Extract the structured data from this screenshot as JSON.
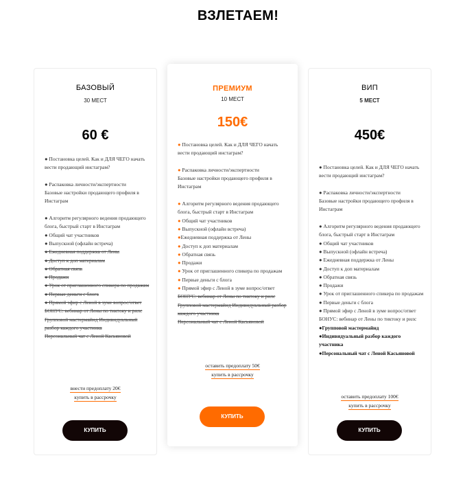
{
  "page": {
    "title": "ВЗЛЕТАЕМ!"
  },
  "colors": {
    "accent": "#ff6b00",
    "button_dark": "#120606"
  },
  "plans": [
    {
      "name": "БАЗОВЫЙ",
      "seats": "30 МЕСТ",
      "price": "60 €",
      "features": [
        "● Постановка целей. Как и ДЛЯ ЧЕГО начать вести продающий инстаграм?",
        "● Распаковка личности/экспертности\nБазовые настройки продающего профиля в Инстаграм",
        "● Алгоритм регулярного ведения продающего блога, быстрый старт в Инстаграм",
        "● Общий чат участников",
        "● Выпускной (офлайн встреча)",
        "● Ежедневная поддержка от Лены",
        "● Доступ к доп материалам",
        "● Обратная связь",
        "● Продажи",
        "● Урок от приглашенного спикера по продажам",
        "● Первые деньги с блога",
        "● Прямой эфир с Леной в зуме вопрос/ответ",
        "БОНУС: вебинар от Лены по тиктоку и рилс",
        "Групповой мастермайнд Индивидуальный разбор каждого участника",
        "Персональный чат с Леной Касьяновой"
      ],
      "link_prepay": "внести предоплату 20€",
      "link_installment": "купить в рассрочку",
      "buy_label": "КУПИТЬ"
    },
    {
      "name": "ПРЕМИУМ",
      "seats": "10 МЕСТ",
      "price": "150€",
      "features": [
        "● Постановка целей. Как и ДЛЯ ЧЕГО начать вести продающий инстаграм?",
        "● Распаковка личности/экспертности\nБазовые настройки продающего профиля в Инстаграм",
        "● Алгоритм регулярного ведения продающего блога, быстрый старт в Инстаграм",
        "● Общий чат участников",
        "● Выпускной (офлайн встреча)",
        "●Ежедневная поддержка от Лены",
        "● Доступ к доп материалам",
        "● Обратная связь",
        "● Продажи",
        "● Урок от приглашенного спикера по продажам",
        "● Первые деньги с блога",
        "● Прямой эфир с Леной в зуме вопрос/ответ",
        "БОНУС: вебинар от Лены по тиктоку и рилс Групповой мастермайнд Индивидуальный разбор каждого участника",
        "Персональный чат с Леной Касьяновой"
      ],
      "link_prepay": "оставить предоплату 50€",
      "link_installment": "купить в рассрочку",
      "buy_label": "КУПИТЬ"
    },
    {
      "name": "ВИП",
      "seats": "5 МЕСТ",
      "price": "450€",
      "features": [
        "● Постановка целей. Как и ДЛЯ ЧЕГО начать вести продающий инстаграм?",
        "● Распаковка личности/экспертности\nБазовые настройки продающего профиля в Инстаграм",
        "● Алгоритм регулярного ведения продающего блога, быстрый старт в Инстаграм",
        "● Общий чат участников",
        "● Выпускной (офлайн встреча)",
        "● Ежедневная поддержка от Лены",
        "● Доступ к доп материалам",
        "● Обратная связь",
        "● Продажи",
        "● Урок от приглашенного спикера по продажам",
        "● Первые деньги с блога",
        "● Прямой эфир с Леной в зуме вопрос/ответ",
        "БОНУС: вебинар от Лены по тиктоку и рилс",
        "●Групповой мастермайнд",
        "●Индивидуальный разбор каждого участника",
        "●Персональный чат с Леной Касьяновой"
      ],
      "link_prepay": "оставить предоплату 100€",
      "link_installment": "купить в рассрочку",
      "buy_label": "КУПИТЬ"
    }
  ]
}
